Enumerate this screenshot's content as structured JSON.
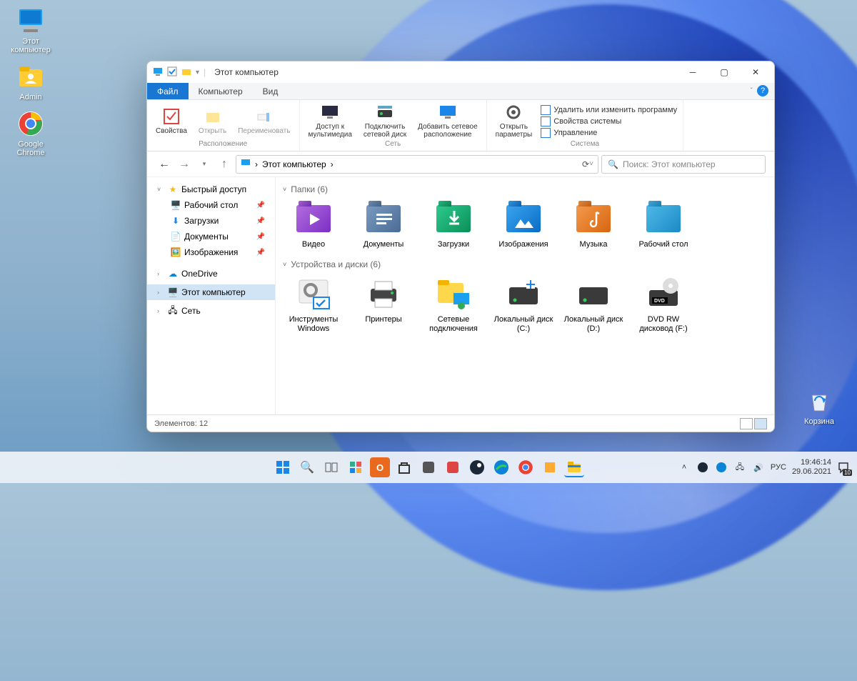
{
  "desktop_icons": [
    {
      "name": "this-pc",
      "label": "Этот\nкомпьютер"
    },
    {
      "name": "admin",
      "label": "Admin"
    },
    {
      "name": "chrome",
      "label": "Google\nChrome"
    }
  ],
  "recycle_bin_label": "Корзина",
  "explorer": {
    "title": "Этот компьютер",
    "tabs": [
      {
        "label": "Файл",
        "active": true
      },
      {
        "label": "Компьютер",
        "active": false
      },
      {
        "label": "Вид",
        "active": false
      }
    ],
    "ribbon": {
      "group1": {
        "label": "Расположение",
        "buttons": [
          {
            "label": "Свойства"
          },
          {
            "label": "Открыть"
          },
          {
            "label": "Переименовать"
          }
        ]
      },
      "group2": {
        "label": "Сеть",
        "buttons": [
          {
            "label": "Доступ к\nмультимедиа"
          },
          {
            "label": "Подключить\nсетевой диск"
          },
          {
            "label": "Добавить сетевое\nрасположение"
          }
        ]
      },
      "group3": {
        "label": "Система",
        "button": {
          "label": "Открыть\nпараметры"
        },
        "list": [
          "Удалить или изменить программу",
          "Свойства системы",
          "Управление"
        ]
      }
    },
    "breadcrumb": "Этот компьютер",
    "search_placeholder": "Поиск: Этот компьютер",
    "sidebar": {
      "quick_access": "Быстрый доступ",
      "items": [
        {
          "label": "Рабочий стол",
          "pin": true
        },
        {
          "label": "Загрузки",
          "pin": true
        },
        {
          "label": "Документы",
          "pin": true
        },
        {
          "label": "Изображения",
          "pin": true
        }
      ],
      "onedrive": "OneDrive",
      "this_pc": "Этот компьютер",
      "network": "Сеть"
    },
    "sections": {
      "folders": {
        "title": "Папки (6)",
        "items": [
          {
            "label": "Видео",
            "color": "#8e3fd3"
          },
          {
            "label": "Документы",
            "color": "#5b7ba3"
          },
          {
            "label": "Загрузки",
            "color": "#17a571"
          },
          {
            "label": "Изображения",
            "color": "#1b86e8"
          },
          {
            "label": "Музыка",
            "color": "#e57b2b"
          },
          {
            "label": "Рабочий стол",
            "color": "#2ea0d6"
          }
        ]
      },
      "drives": {
        "title": "Устройства и диски (6)",
        "items": [
          {
            "label": "Инструменты\nWindows"
          },
          {
            "label": "Принтеры"
          },
          {
            "label": "Сетевые\nподключения"
          },
          {
            "label": "Локальный диск\n(C:)"
          },
          {
            "label": "Локальный диск\n(D:)"
          },
          {
            "label": "DVD RW\nдисковод (F:)"
          }
        ]
      }
    },
    "status": "Элементов: 12"
  },
  "taskbar": {
    "tray_lang": "РУС",
    "time": "19:46:14",
    "date": "29.06.2021",
    "notif_badge": "10"
  }
}
